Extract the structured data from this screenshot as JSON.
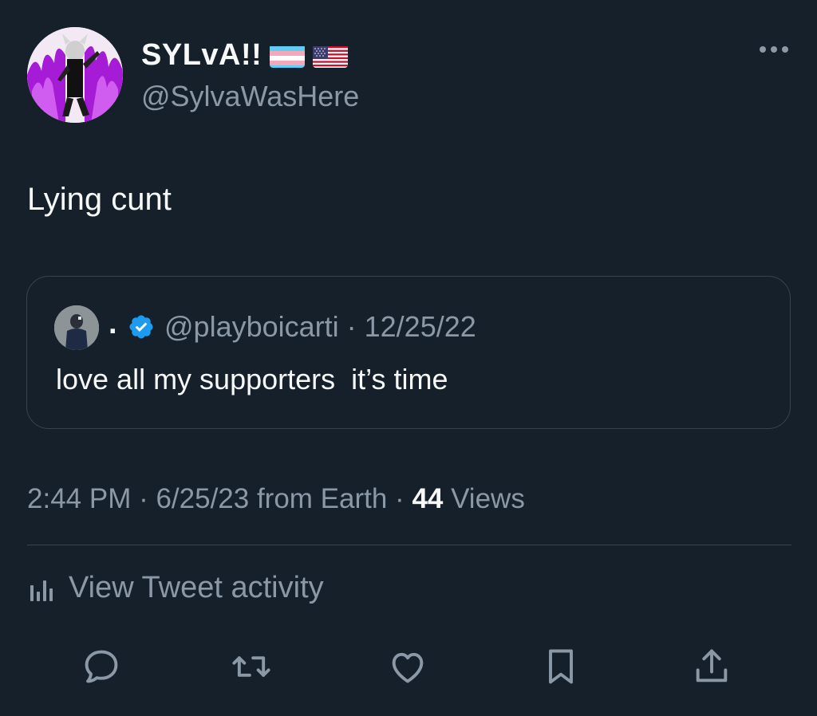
{
  "author": {
    "display_name": "SYLvA!!",
    "flags": [
      "transgender-flag",
      "us-flag"
    ],
    "handle": "@SylvaWasHere",
    "avatar_icon": "avatar-purple-flames"
  },
  "tweet": {
    "text": "Lying cunt",
    "time": "2:44 PM · 6/25/23 from Earth · ",
    "views_count": "44",
    "views_label": " Views"
  },
  "quoted": {
    "name": ".",
    "handle_date": "@playboicarti · 12/25/22",
    "text": "love all my supporters  it’s time",
    "verified": true
  },
  "activity": {
    "label": "View Tweet activity"
  },
  "actions": [
    "reply-icon",
    "retweet-icon",
    "like-icon",
    "bookmark-icon",
    "share-icon"
  ],
  "colors": {
    "background": "#15202b",
    "text": "#f7f9f9",
    "secondary": "#8b98a5",
    "border": "#38444d",
    "verified": "#1d9bf0"
  }
}
